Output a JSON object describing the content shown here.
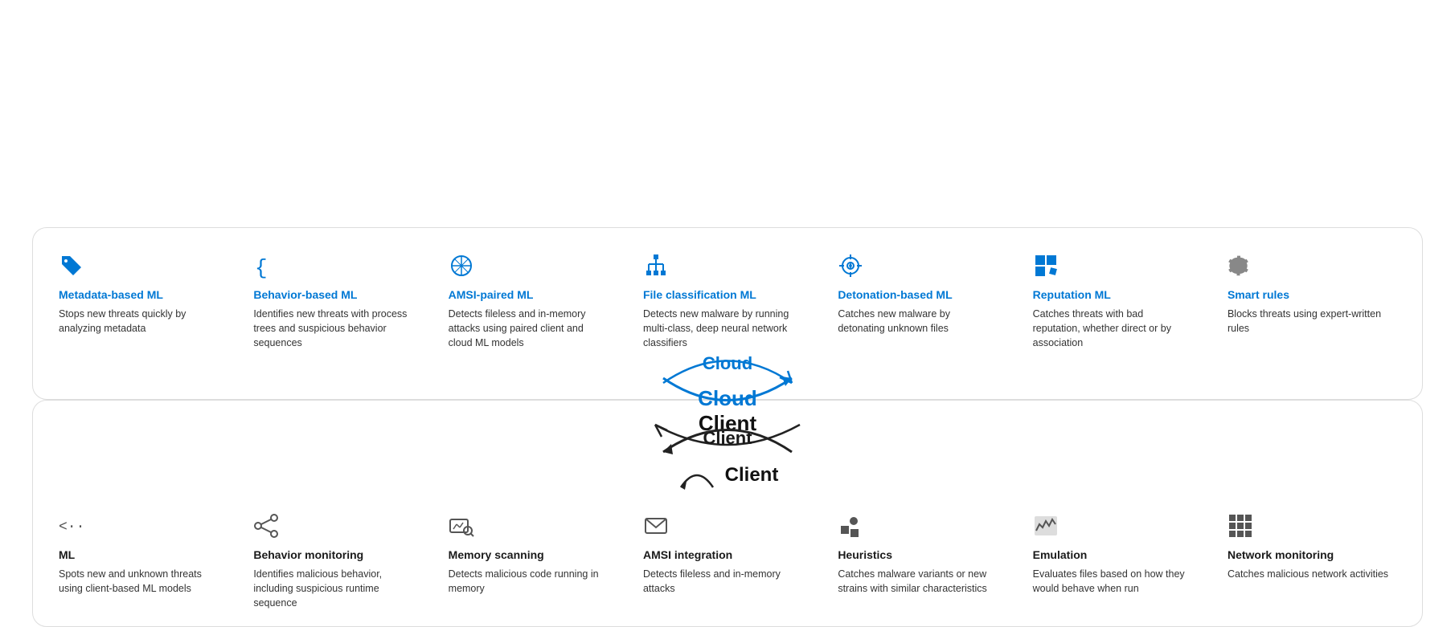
{
  "cloud_panel": {
    "label": "Cloud",
    "items": [
      {
        "id": "metadata-ml",
        "title": "Metadata-based ML",
        "desc": "Stops new threats quickly by analyzing metadata",
        "icon": "tag"
      },
      {
        "id": "behavior-ml",
        "title": "Behavior-based ML",
        "desc": "Identifies new threats with process trees and suspicious behavior sequences",
        "icon": "braces"
      },
      {
        "id": "amsi-ml",
        "title": "AMSI-paired ML",
        "desc": "Detects fileless and in-memory attacks using paired client and cloud ML models",
        "icon": "network"
      },
      {
        "id": "file-class-ml",
        "title": "File classification ML",
        "desc": "Detects new malware by running multi-class, deep neural network classifiers",
        "icon": "hierarchy"
      },
      {
        "id": "detonation-ml",
        "title": "Detonation-based ML",
        "desc": "Catches new malware by detonating unknown files",
        "icon": "crosshair"
      },
      {
        "id": "reputation-ml",
        "title": "Reputation ML",
        "desc": "Catches threats with bad reputation, whether direct or by association",
        "icon": "squares"
      },
      {
        "id": "smart-rules",
        "title": "Smart rules",
        "desc": "Blocks threats using expert-written rules",
        "icon": "gear"
      }
    ]
  },
  "client_panel": {
    "label": "Client",
    "items": [
      {
        "id": "ml-client",
        "title": "ML",
        "desc": "Spots new and unknown threats using client-based ML models",
        "icon": "arrows"
      },
      {
        "id": "behavior-monitor",
        "title": "Behavior monitoring",
        "desc": "Identifies malicious behavior, including suspicious runtime sequence",
        "icon": "share"
      },
      {
        "id": "memory-scan",
        "title": "Memory scanning",
        "desc": "Detects malicious code running in memory",
        "icon": "chart-search"
      },
      {
        "id": "amsi-int",
        "title": "AMSI integration",
        "desc": "Detects fileless and in-memory attacks",
        "icon": "envelope"
      },
      {
        "id": "heuristics",
        "title": "Heuristics",
        "desc": "Catches malware variants or new strains with similar characteristics",
        "icon": "dots"
      },
      {
        "id": "emulation",
        "title": "Emulation",
        "desc": "Evaluates files based on how they would behave when run",
        "icon": "chart-wave"
      },
      {
        "id": "network-mon",
        "title": "Network monitoring",
        "desc": "Catches malicious network activities",
        "icon": "grid"
      }
    ]
  }
}
